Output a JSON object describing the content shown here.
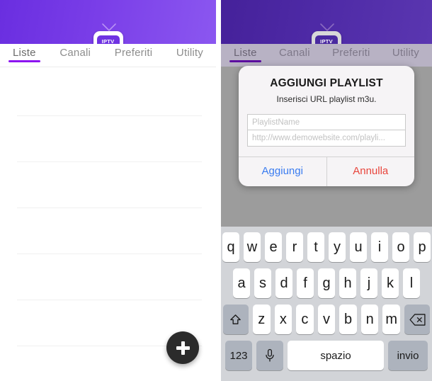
{
  "app": {
    "logo_text": "IPTV",
    "logo_icon": "iptv-tv-logo",
    "header_color": "#6f33e2",
    "accent_color": "#8c14f0"
  },
  "tabs": [
    {
      "label": "Liste",
      "active": true
    },
    {
      "label": "Canali",
      "active": false
    },
    {
      "label": "Preferiti",
      "active": false
    },
    {
      "label": "Utility",
      "active": false
    }
  ],
  "list": {
    "items": [],
    "separator_count": 6
  },
  "fab": {
    "icon": "plus-icon",
    "label": "+"
  },
  "dialog": {
    "title": "AGGIUNGI PLAYLIST",
    "subtitle": "Inserisci URL playlist m3u.",
    "fields": [
      {
        "name": "playlist-name",
        "value": "",
        "placeholder": "PlaylistName"
      },
      {
        "name": "playlist-url",
        "value": "",
        "placeholder": "http://www.demowebsite.com/playli..."
      }
    ],
    "confirm_label": "Aggiungi",
    "cancel_label": "Annulla",
    "confirm_color": "#3a7cf0",
    "cancel_color": "#e8453c"
  },
  "keyboard": {
    "row1": [
      "q",
      "w",
      "e",
      "r",
      "t",
      "y",
      "u",
      "i",
      "o",
      "p"
    ],
    "row2": [
      "a",
      "s",
      "d",
      "f",
      "g",
      "h",
      "j",
      "k",
      "l"
    ],
    "row3": [
      "z",
      "x",
      "c",
      "v",
      "b",
      "n",
      "m"
    ],
    "shift_icon": "shift-arrow-icon",
    "backspace_icon": "backspace-icon",
    "numbers_label": "123",
    "mic_icon": "microphone-icon",
    "space_label": "spazio",
    "enter_label": "invio"
  }
}
